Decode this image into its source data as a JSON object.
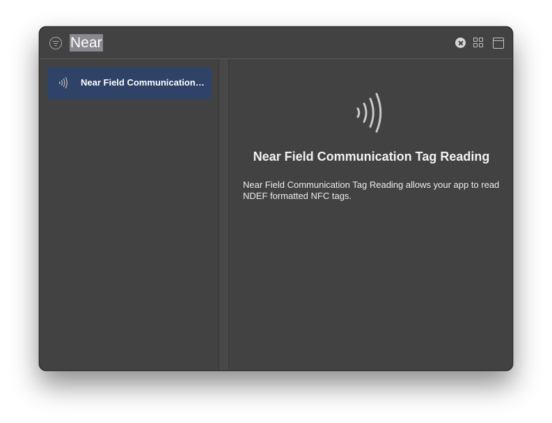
{
  "search": {
    "query": "Near",
    "placeholder": ""
  },
  "toolbar": {
    "filter_icon": "filter-circle-icon",
    "clear_icon": "clear-circle-x-icon",
    "grid_icon": "grid-view-icon",
    "panel_icon": "window-panel-icon"
  },
  "results": {
    "items": [
      {
        "label": "Near Field Communication Tag Reading",
        "icon": "nfc-waves-icon",
        "selected": true
      }
    ]
  },
  "detail": {
    "icon": "nfc-waves-icon",
    "title": "Near Field Communication Tag Reading",
    "description": "Near Field Communication Tag Reading allows your app to read NDEF formatted NFC tags."
  },
  "colors": {
    "window_bg": "#424242",
    "selection": "#2f4268",
    "search_highlight": "#8a8890"
  }
}
